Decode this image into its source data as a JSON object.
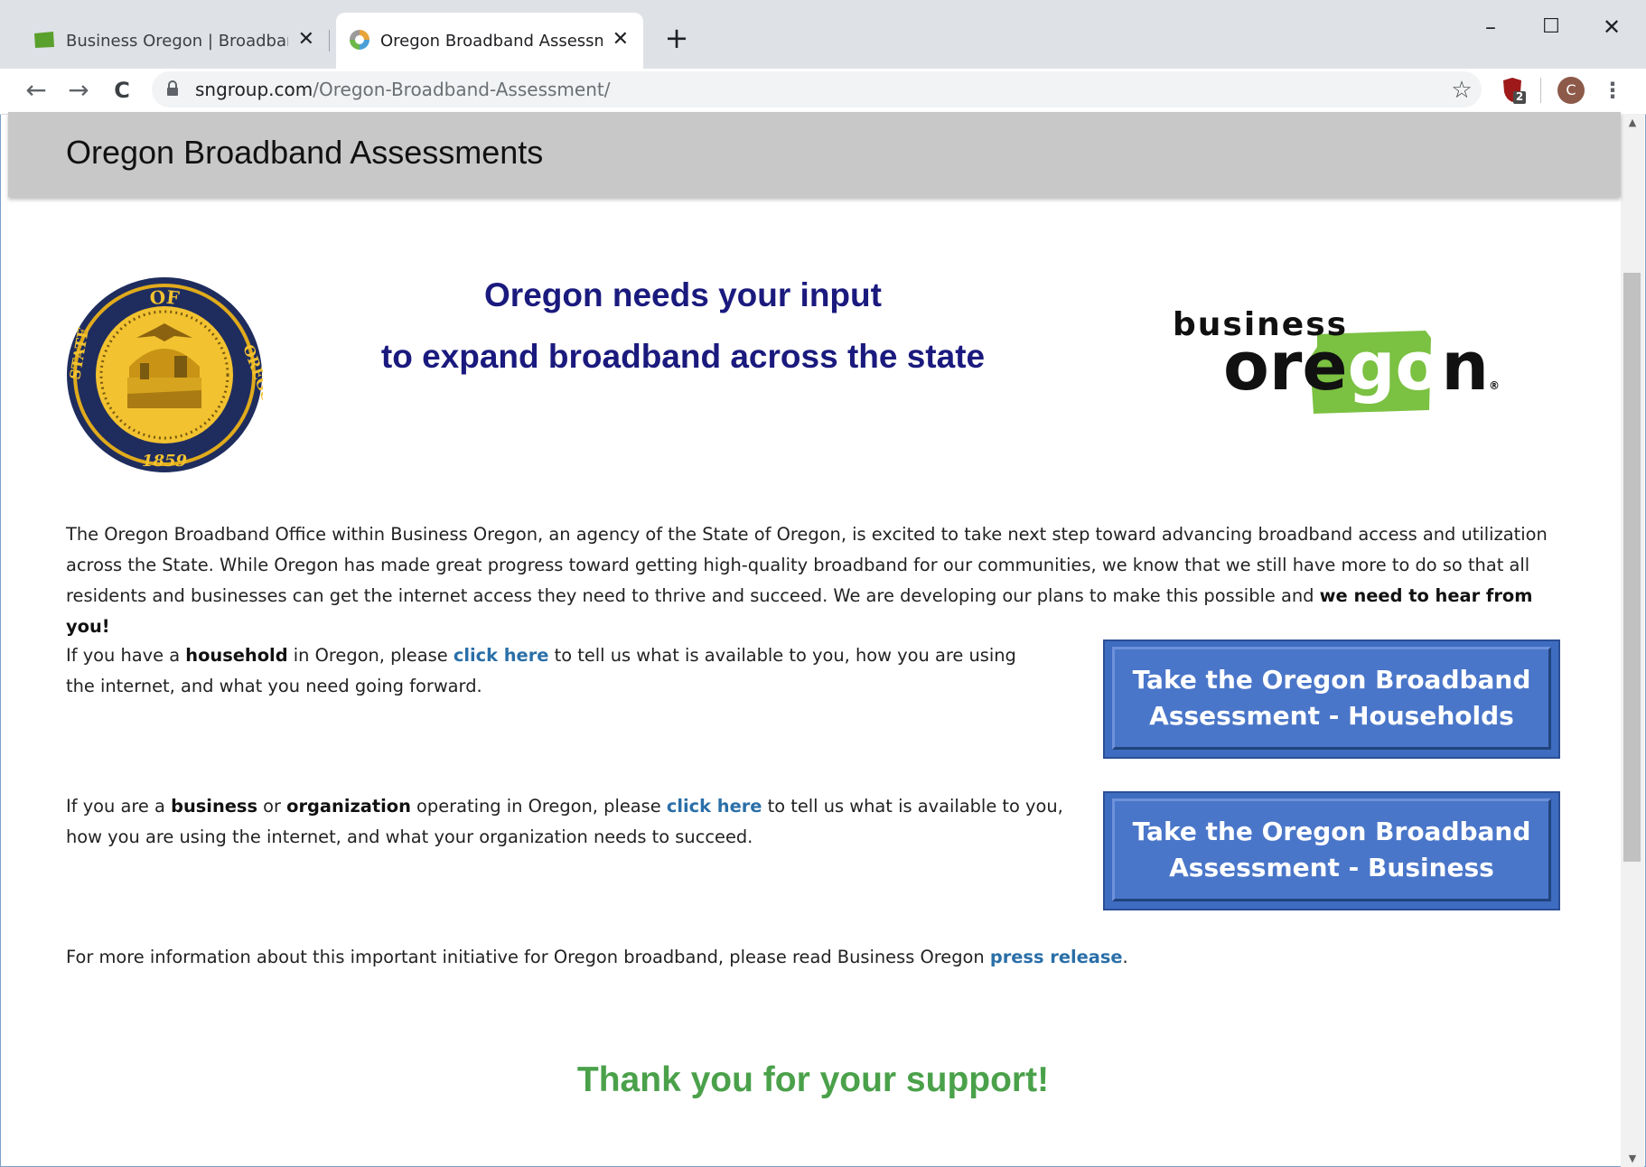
{
  "browser": {
    "tabs": [
      {
        "title": "Business Oregon | Broadband Office",
        "icon": "oregon-map-favicon",
        "active": false
      },
      {
        "title": "Oregon Broadband Assessments",
        "icon": "sn-group-favicon",
        "active": true
      }
    ],
    "close_glyph": "✕",
    "new_tab_glyph": "+",
    "window_controls": {
      "minimize": "–",
      "maximize": "☐",
      "close": "✕"
    },
    "nav": {
      "back": "←",
      "forward": "→",
      "reload": "C"
    },
    "url_host": "sngroup.com",
    "url_path": "/Oregon-Broadband-Assessment/",
    "ublock_badge": "2",
    "profile_initial": "C",
    "menu_glyph": "⋮",
    "star_glyph": "☆"
  },
  "page": {
    "header_title": "Oregon Broadband Assessments",
    "headline_line1": "Oregon needs your input",
    "headline_line2": "to expand broadband across the state",
    "seal": {
      "top_text": "OF",
      "state_text": "STATE",
      "oregon_text": "OREGON",
      "year": "1859"
    },
    "logo": {
      "business": "business",
      "oregon_pre": "ore",
      "oregon_go": "go",
      "oregon_post": "n",
      "registered": "®"
    },
    "intro": {
      "text": "The Oregon Broadband Office within Business Oregon, an agency of the State of Oregon, is excited to take next step toward advancing broadband access and utilization across the State. While Oregon has made great progress toward getting high-quality broadband for our communities, we know that we still have more to do so that all residents and businesses can get the internet access they need to thrive and succeed. We are developing our plans to make this possible and",
      "bold": "we need to hear from you!"
    },
    "household": {
      "t1": "If you have a ",
      "b1": "household",
      "t2": " in Oregon, please ",
      "link": "click here",
      "t3": " to tell us what is available to you, how you are using the internet, and what you need going forward."
    },
    "business": {
      "t1": "If you are a ",
      "b1": "business",
      "t2": " or ",
      "b2": "organization",
      "t3": " operating in Oregon, please ",
      "link": "click here",
      "t4": " to tell us what is available to you, how you are using the internet, and what your organization needs to succeed."
    },
    "more_info": {
      "text": "For more information about this important initiative for Oregon broadband, please read Business Oregon ",
      "link": "press release",
      "end": "."
    },
    "household_button": {
      "line1": "Take the Oregon Broadband",
      "line2": "Assessment - Households"
    },
    "business_button": {
      "line1": "Take the Oregon Broadband",
      "line2": "Assessment - Business"
    },
    "thanks": "Thank you for your support!"
  },
  "colors": {
    "headline": "#1a1a7e",
    "link": "#2a6fa8",
    "button": "#4a76c9",
    "thanks": "#4aa14a",
    "oregon_green": "#7bc142"
  }
}
